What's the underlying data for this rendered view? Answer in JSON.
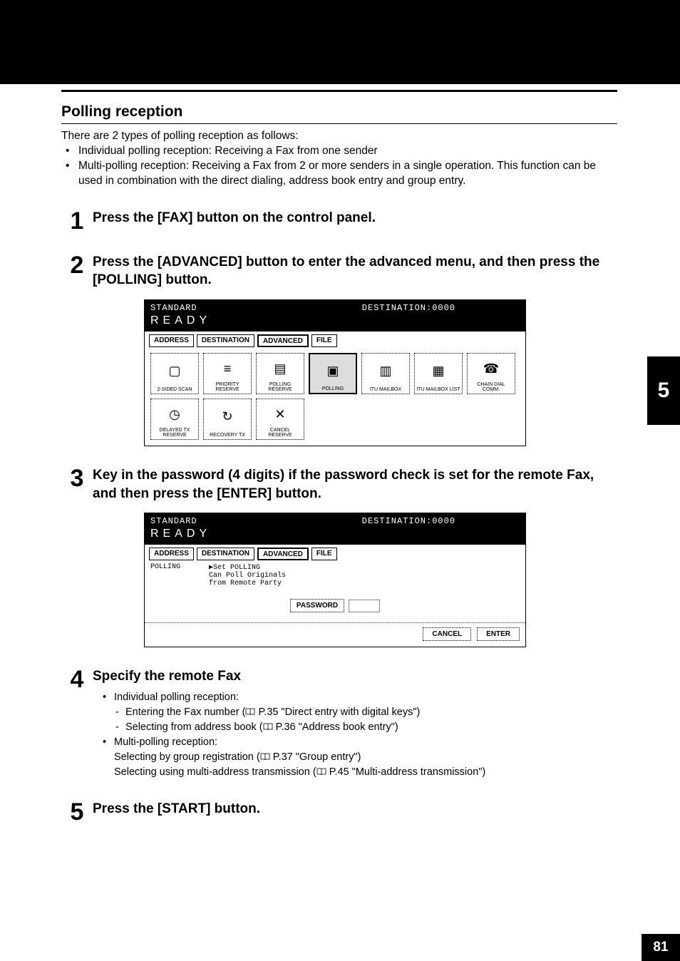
{
  "section_title": "Polling reception",
  "intro": "There are 2 types of polling reception as follows:",
  "intro_bullets": [
    "Individual polling reception: Receiving a Fax from one sender",
    "Multi-polling reception: Receiving a Fax from 2 or more senders in a single operation. This function can be used in combination with the direct dialing, address book entry and group entry."
  ],
  "steps": {
    "s1": {
      "n": "1",
      "title": "Press the [FAX] button on the control panel."
    },
    "s2": {
      "n": "2",
      "title": "Press the [ADVANCED] button to enter the advanced menu, and then press the [POLLING] button."
    },
    "s3": {
      "n": "3",
      "title": "Key in the password (4 digits) if the password check is set for the remote Fax, and then press the [ENTER] button."
    },
    "s4": {
      "n": "4",
      "title": "Specify the remote Fax",
      "b1": "Individual polling reception:",
      "d1a": "Entering the Fax number (",
      "d1b": " P.35 \"Direct entry with digital keys\")",
      "d2a": "Selecting from address book (",
      "d2b": " P.36 \"Address book entry\")",
      "b2": "Multi-polling reception:",
      "l1a": "Selecting by group registration (",
      "l1b": " P.37 \"Group entry\")",
      "l2a": "Selecting using multi-address transmission (",
      "l2b": " P.45 \"Multi-address transmission\")"
    },
    "s5": {
      "n": "5",
      "title": "Press the [START] button."
    }
  },
  "screen1": {
    "top_left": "STANDARD",
    "top_right": "DESTINATION:0000",
    "ready": "READY",
    "tabs": {
      "address": "ADDRESS",
      "destination": "DESTINATION",
      "advanced": "ADVANCED",
      "file": "FILE"
    },
    "fn": {
      "b0": "2-SIDED SCAN",
      "b1": "PRIORITY RESERVE",
      "b2": "POLLING RESERVE",
      "b3": "POLLING",
      "b4": "ITU MAILBOX",
      "b5": "ITU MAILBOX LIST",
      "b6": "CHAIN DIAL COMM.",
      "b7": "DELAYED TX RESERVE",
      "b8": "RECOVERY TX",
      "b9": "CANCEL RESERVE"
    }
  },
  "screen2": {
    "top_left": "STANDARD",
    "top_right": "DESTINATION:0000",
    "ready": "READY",
    "tabs": {
      "address": "ADDRESS",
      "destination": "DESTINATION",
      "advanced": "ADVANCED",
      "file": "FILE"
    },
    "left_label": "POLLING",
    "desc1": "▶Set POLLING",
    "desc2": "Can Poll Originals",
    "desc3": "from Remote Party",
    "password_label": "PASSWORD",
    "cancel": "CANCEL",
    "enter": "ENTER"
  },
  "side_tab": "5",
  "page_number": "81"
}
